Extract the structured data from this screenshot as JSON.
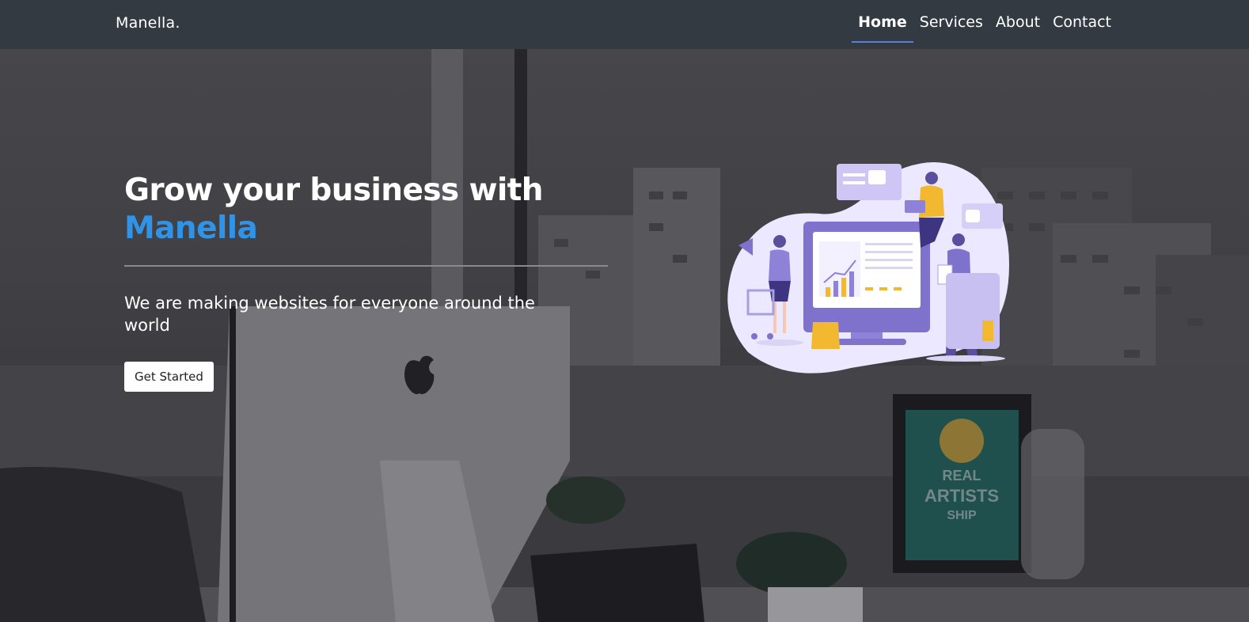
{
  "navbar": {
    "brand": "Manella.",
    "items": [
      {
        "label": "Home",
        "active": true
      },
      {
        "label": "Services",
        "active": false
      },
      {
        "label": "About",
        "active": false
      },
      {
        "label": "Contact",
        "active": false
      }
    ]
  },
  "hero": {
    "title_prefix": "Grow your business with ",
    "title_accent": "Manella",
    "subtitle": "We are making websites for everyone around the world",
    "cta_label": "Get Started",
    "poster_text": {
      "line1": "REAL",
      "line2": "ARTISTS",
      "line3": "SHIP"
    }
  },
  "colors": {
    "navbar_bg": "#343a42",
    "accent": "#2f94e8",
    "active_underline": "#5a7fd6"
  }
}
